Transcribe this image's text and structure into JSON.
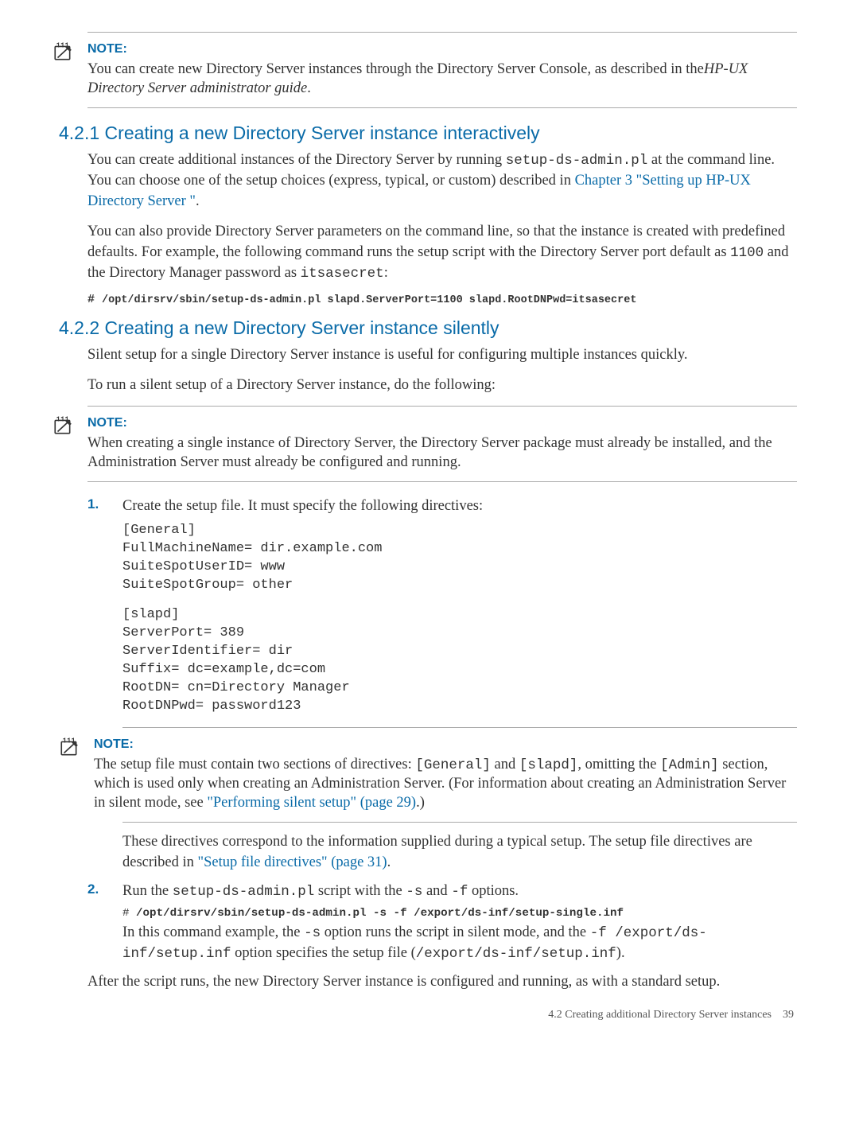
{
  "note1": {
    "title": "NOTE:",
    "body_before": "You can create new Directory Server instances through the Directory Server Console, as described in the",
    "body_italic": "HP-UX Directory Server administrator guide",
    "body_after": "."
  },
  "section1": {
    "heading": "4.2.1 Creating a new Directory Server instance interactively",
    "p1_before": "You can create additional instances of the Directory Server by running ",
    "p1_mono": "setup-ds-admin.pl",
    "p1_after": " at the command line. You can choose one of the setup choices (express, typical, or custom) described in ",
    "p1_link": "Chapter 3 \"Setting up HP-UX Directory Server \"",
    "p1_end": ".",
    "p2_before": "You can also provide Directory Server parameters on the command line, so that the instance is created with predefined defaults. For example, the following command runs the setup script with the Directory Server port default as ",
    "p2_mono1": "1100",
    "p2_mid": " and the Directory Manager password as ",
    "p2_mono2": "itsasecret",
    "p2_end": ":",
    "cmd_hash": "# ",
    "cmd": "/opt/dirsrv/sbin/setup-ds-admin.pl slapd.ServerPort=1100 slapd.RootDNPwd=itsasecret"
  },
  "section2": {
    "heading": "4.2.2 Creating a new Directory Server instance silently",
    "p1": "Silent setup for a single Directory Server instance is useful for configuring multiple instances quickly.",
    "p2": "To run a silent setup of a Directory Server instance, do the following:"
  },
  "note2": {
    "title": "NOTE:",
    "body": "When creating a single instance of Directory Server, the Directory Server package must already be installed, and the Administration Server must already be configured and running."
  },
  "step1": {
    "num": "1.",
    "text": "Create the setup file. It must specify the following directives:",
    "snippet1": "[General]\nFullMachineName= dir.example.com\nSuiteSpotUserID= www\nSuiteSpotGroup= other",
    "snippet2": "[slapd]\nServerPort= 389\nServerIdentifier= dir\nSuffix= dc=example,dc=com\nRootDN= cn=Directory Manager\nRootDNPwd= password123"
  },
  "note3": {
    "title": "NOTE:",
    "body1": "The setup file must contain two sections of directives: ",
    "mono1": "[General]",
    "mid1": " and ",
    "mono2": "[slapd]",
    "after2": ", omitting the ",
    "mono3": "[Admin]",
    "after3": " section, which is used only when creating an Administration Server. (For information about creating an Administration Server in silent mode, see ",
    "link": "\"Performing silent setup\" (page 29)",
    "end": ".)"
  },
  "step1_p2": {
    "before": "These directives correspond to the information supplied during a typical setup. The setup file directives are described in ",
    "link": "\"Setup file directives\" (page 31)",
    "after": "."
  },
  "step2": {
    "num": "2.",
    "text_before": "Run the ",
    "mono1": "setup-ds-admin.pl",
    "mid1": " script with the ",
    "mono2": "-s",
    "mid2": " and ",
    "mono3": "-f",
    "after": " options.",
    "cmd_hash": "# ",
    "cmd": "/opt/dirsrv/sbin/setup-ds-admin.pl -s -f /export/ds-inf/setup-single.inf",
    "p2_before": "In this command example, the ",
    "p2_mono1": "-s",
    "p2_mid1": " option runs the script in silent mode, and the ",
    "p2_mono2": "-f /export/ds-inf/setup.inf",
    "p2_mid2": " option specifies the setup file (",
    "p2_mono3": "/export/ds-inf/setup.inf",
    "p2_end": ")."
  },
  "closing": "After the script runs, the new Directory Server instance is configured and running, as with a standard setup.",
  "footer": {
    "section": "4.2 Creating additional Directory Server instances",
    "page": "39"
  }
}
